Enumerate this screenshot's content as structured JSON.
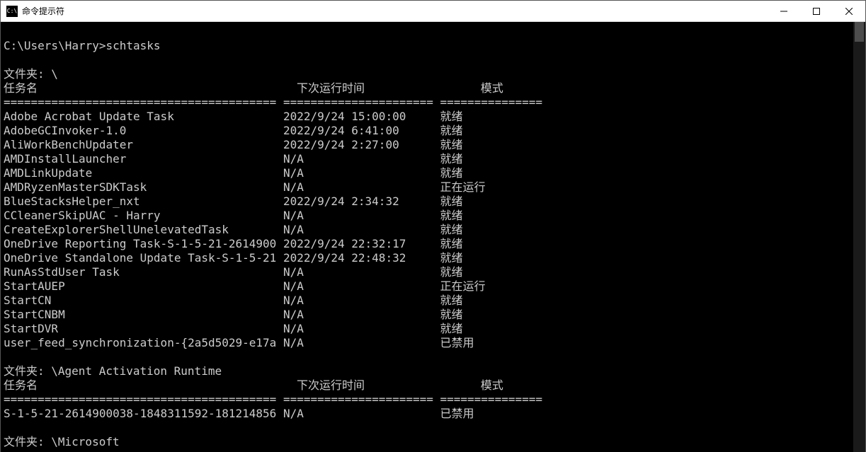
{
  "window": {
    "title": "命令提示符",
    "icon_label": "C:\\"
  },
  "prompt": {
    "path": "C:\\Users\\Harry>",
    "command": "schtasks"
  },
  "labels": {
    "folder_prefix": "文件夹: ",
    "col_task": "任务名",
    "col_next": "下次运行时间",
    "col_mode": "模式"
  },
  "separators": {
    "col1": "========================================",
    "col2": "======================",
    "col3": "===============",
    "col3_line": "================"
  },
  "folders": [
    {
      "path": "\\",
      "tasks": [
        {
          "name": "Adobe Acrobat Update Task",
          "next": "2022/9/24 15:00:00",
          "mode": "就绪"
        },
        {
          "name": "AdobeGCInvoker-1.0",
          "next": "2022/9/24 6:41:00",
          "mode": "就绪"
        },
        {
          "name": "AliWorkBenchUpdater",
          "next": "2022/9/24 2:27:00",
          "mode": "就绪"
        },
        {
          "name": "AMDInstallLauncher",
          "next": "N/A",
          "mode": "就绪"
        },
        {
          "name": "AMDLinkUpdate",
          "next": "N/A",
          "mode": "就绪"
        },
        {
          "name": "AMDRyzenMasterSDKTask",
          "next": "N/A",
          "mode": "正在运行"
        },
        {
          "name": "BlueStacksHelper_nxt",
          "next": "2022/9/24 2:34:32",
          "mode": "就绪"
        },
        {
          "name": "CCleanerSkipUAC - Harry",
          "next": "N/A",
          "mode": "就绪"
        },
        {
          "name": "CreateExplorerShellUnelevatedTask",
          "next": "N/A",
          "mode": "就绪"
        },
        {
          "name": "OneDrive Reporting Task-S-1-5-21-2614900",
          "next": "2022/9/24 22:32:17",
          "mode": "就绪"
        },
        {
          "name": "OneDrive Standalone Update Task-S-1-5-21",
          "next": "2022/9/24 22:48:32",
          "mode": "就绪"
        },
        {
          "name": "RunAsStdUser Task",
          "next": "N/A",
          "mode": "就绪"
        },
        {
          "name": "StartAUEP",
          "next": "N/A",
          "mode": "正在运行"
        },
        {
          "name": "StartCN",
          "next": "N/A",
          "mode": "就绪"
        },
        {
          "name": "StartCNBM",
          "next": "N/A",
          "mode": "就绪"
        },
        {
          "name": "StartDVR",
          "next": "N/A",
          "mode": "就绪"
        },
        {
          "name": "user_feed_synchronization-{2a5d5029-e17a",
          "next": "N/A",
          "mode": "已禁用"
        }
      ]
    },
    {
      "path": "\\Agent Activation Runtime",
      "tasks": [
        {
          "name": "S-1-5-21-2614900038-1848311592-181214856",
          "next": "N/A",
          "mode": "已禁用"
        }
      ]
    },
    {
      "path": "\\Microsoft",
      "tasks": []
    }
  ]
}
